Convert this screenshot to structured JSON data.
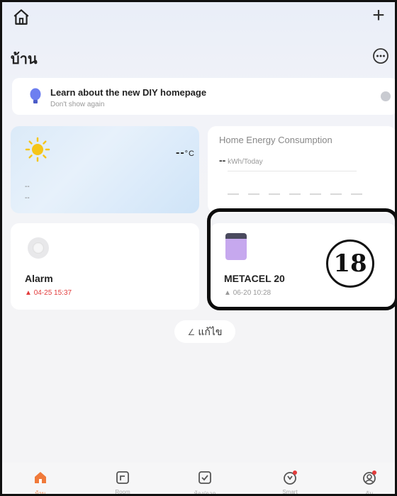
{
  "header": {
    "title": "บ้าน"
  },
  "banner": {
    "title": "Learn about the new DIY homepage",
    "subtitle": "Don't show again"
  },
  "weather": {
    "temperature": "--",
    "unit": "°C",
    "line1": "--",
    "line2": "--"
  },
  "energy": {
    "title": "Home Energy Consumption",
    "value": "--",
    "unit": "kWh/Today"
  },
  "devices": [
    {
      "name": "Alarm",
      "time": "04-25 15:37"
    },
    {
      "name": "METACEL 20",
      "time": "06-20 10:28"
    }
  ],
  "callout": {
    "number": "18"
  },
  "edit": {
    "label": "แก้ไข"
  },
  "tabs": [
    {
      "label": "บ้าน",
      "icon": "home-icon"
    },
    {
      "label": "Room",
      "icon": "room-icon"
    },
    {
      "label": "ห้อง/ฉาก",
      "icon": "scene-icon"
    },
    {
      "label": "Smart",
      "icon": "smart-icon"
    },
    {
      "label": "ฉัน",
      "icon": "me-icon"
    }
  ],
  "colors": {
    "accent": "#f07a3a",
    "alert": "#e23b3b",
    "device": "#c6a8ee"
  }
}
